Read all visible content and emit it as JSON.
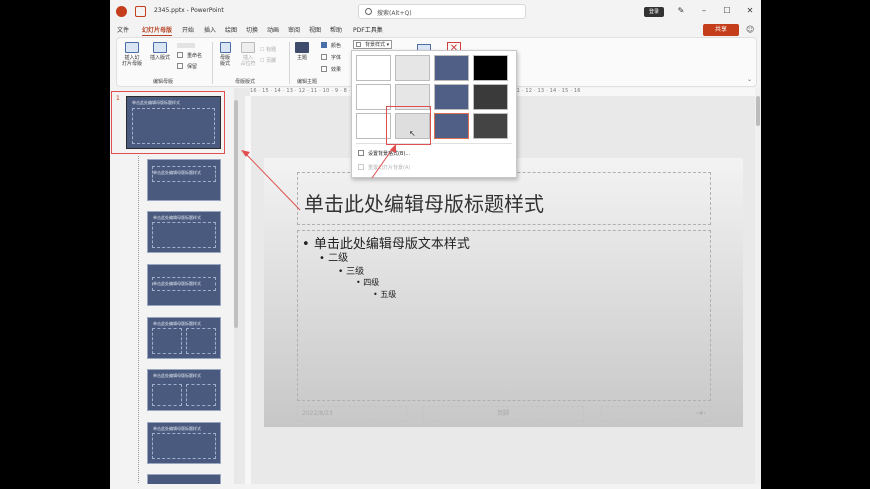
{
  "window": {
    "file_title": "2345.pptx  -  PowerPoint",
    "login": "登录"
  },
  "search": {
    "placeholder": "搜索(Alt+Q)"
  },
  "menu_tabs": [
    "文件",
    "幻灯片母版",
    "开始",
    "插入",
    "绘图",
    "切换",
    "动画",
    "审阅",
    "视图",
    "帮助",
    "PDF工具集"
  ],
  "share": "共享",
  "ribbon": {
    "insert_master": "插入幻\n灯片母版",
    "insert_layout": "插入版式",
    "rename": "重命名",
    "preserve": "保留",
    "master_layout": "母版\n版式",
    "insert_placeholder": "插入\n占位符",
    "title_cb": "标题",
    "footer_cb": "页脚",
    "themes": "主题",
    "colors": "颜色",
    "fonts": "字体",
    "effects": "效果",
    "background_styles": "背景样式",
    "group_edit_master": "编辑母版",
    "group_master_layout": "母版版式",
    "group_edit_theme": "编辑主题"
  },
  "ruler_text": "16 · 15 · 14 · 13 · 12 · 11 · 10 · 9 · 8 · 7 · 6 · 5 · 4 · 3 · 2 · 1 · 0 · 1 · 2 · 3 · 4 · 5 · 6 · 7 · 8 · 9 · 10 · 11 · 12 · 13 · 14 · 15 · 16",
  "thumbnails": [
    {
      "number": "1",
      "title": "单击此处编辑母版标题样式"
    },
    {
      "title": "单击此处编辑母版标题样式"
    },
    {
      "title": "单击此处编辑母版标题样式"
    },
    {
      "title": "单击此处编辑母版标题样式"
    },
    {
      "title": "单击此处编辑母版标题样式"
    },
    {
      "title": "单击此处编辑母版标题样式"
    },
    {
      "title": "单击此处编辑母版标题样式"
    }
  ],
  "slide": {
    "title": "单击此处编辑母版标题样式",
    "body": [
      "单击此处编辑母版文本样式",
      "二级",
      "三级",
      "四级",
      "五级"
    ],
    "footer_date": "2022/8/23",
    "footer_text": "页脚",
    "footer_num": "‹#›"
  },
  "background_menu": {
    "format_background": "设置背景格式(B)...",
    "reset_background": "重置幻灯片背景(A)"
  },
  "colors": {
    "accent": "#b7472a",
    "thumb_bg": "#4a5a7e",
    "swatches": [
      "#ffffff",
      "#e6e6e6",
      "#4f5f85",
      "#000000",
      "#ffffff",
      "#e6e6e6",
      "#4f5f85",
      "#3a3a3a",
      "#ffffff",
      "#dedede",
      "#4f5f85",
      "#444444"
    ]
  }
}
